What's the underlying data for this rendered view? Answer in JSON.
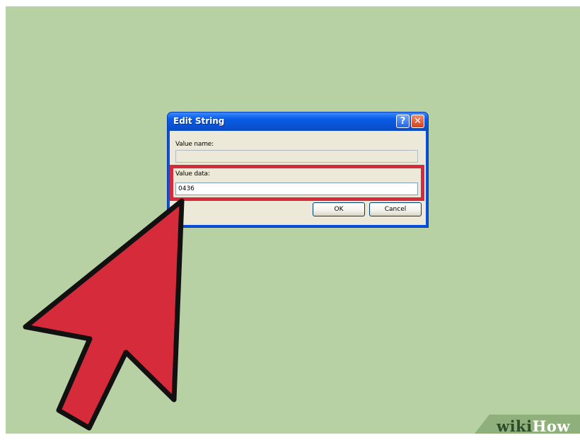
{
  "dialog": {
    "title": "Edit String",
    "help_glyph": "?",
    "close_glyph": "✕",
    "value_name_label": "Value name:",
    "value_name": "",
    "value_data_label": "Value data:",
    "value_data": "0436",
    "ok_label": "OK",
    "cancel_label": "Cancel"
  },
  "colors": {
    "desktop_bg": "#b7d0a4",
    "highlight": "#d62b3a",
    "arrow_fill": "#d62b3a"
  },
  "watermark": {
    "part1": "wiki",
    "part2": "How"
  }
}
